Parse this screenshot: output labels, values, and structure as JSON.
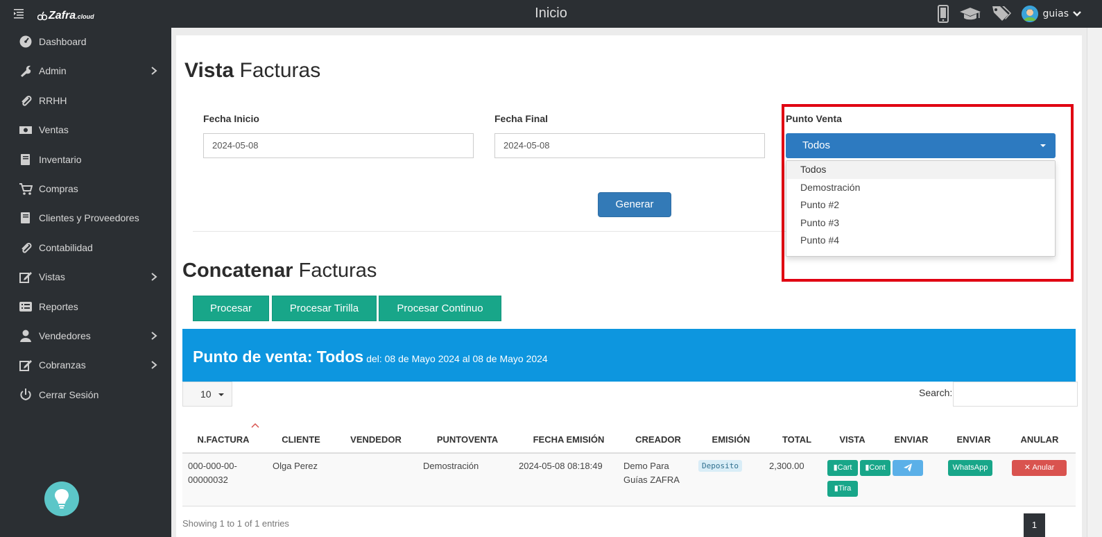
{
  "topbar": {
    "logo_text": "Zafra",
    "logo_suffix": ".cloud",
    "title": "Inicio",
    "username": "guias",
    "icons": [
      "mobile-icon",
      "graduation-cap-icon",
      "tags-icon",
      "user-avatar"
    ]
  },
  "sidebar": {
    "items": [
      {
        "label": "Dashboard",
        "icon": "dashboard-icon",
        "has_children": false
      },
      {
        "label": "Admin",
        "icon": "wrench-icon",
        "has_children": true
      },
      {
        "label": "RRHH",
        "icon": "paperclip-icon",
        "has_children": false
      },
      {
        "label": "Ventas",
        "icon": "money-icon",
        "has_children": false
      },
      {
        "label": "Inventario",
        "icon": "book-icon",
        "has_children": false
      },
      {
        "label": "Compras",
        "icon": "cart-icon",
        "has_children": false
      },
      {
        "label": "Clientes y Proveedores",
        "icon": "book-icon",
        "has_children": false
      },
      {
        "label": "Contabilidad",
        "icon": "paperclip-icon",
        "has_children": false
      },
      {
        "label": "Vistas",
        "icon": "edit-icon",
        "has_children": true
      },
      {
        "label": "Reportes",
        "icon": "list-icon",
        "has_children": false
      },
      {
        "label": "Vendedores",
        "icon": "user-icon",
        "has_children": true
      },
      {
        "label": "Cobranzas",
        "icon": "edit-icon",
        "has_children": true
      },
      {
        "label": "Cerrar Sesión",
        "icon": "power-icon",
        "has_children": false
      }
    ]
  },
  "vista": {
    "title_bold": "Vista",
    "title_rest": "Facturas",
    "fecha_inicio_label": "Fecha Inicio",
    "fecha_inicio_value": "2024-05-08",
    "fecha_final_label": "Fecha Final",
    "fecha_final_value": "2024-05-08",
    "punto_venta_label": "Punto Venta",
    "punto_venta_selected": "Todos",
    "punto_venta_options": [
      "Todos",
      "Demostración",
      "Punto #2",
      "Punto #3",
      "Punto #4"
    ],
    "generar_label": "Generar"
  },
  "concatenar": {
    "title_bold": "Concatenar",
    "title_rest": "Facturas",
    "buttons": [
      "Procesar",
      "Procesar Tirilla",
      "Procesar Continuo"
    ]
  },
  "banner": {
    "title": "Punto de venta: Todos",
    "date_range": "del: 08 de Mayo 2024 al 08 de Mayo 2024"
  },
  "table": {
    "page_length": "10",
    "search_label": "Search:",
    "columns": [
      "N.FACTURA",
      "CLIENTE",
      "VENDEDOR",
      "PUNTOVENTA",
      "FECHA EMISIÓN",
      "CREADOR",
      "EMISIÓN",
      "TOTAL",
      "VISTA",
      "ENVIAR",
      "ENVIAR",
      "ANULAR"
    ],
    "rows": [
      {
        "factura_line1": "000-000-00-",
        "factura_line2": "00000032",
        "cliente": "Olga Perez",
        "vendedor": "",
        "puntoventa": "Demostración",
        "fecha": "2024-05-08 08:18:49",
        "creador_line1": "Demo Para",
        "creador_line2": "Guías ZAFRA",
        "emision": "Deposito",
        "total": "2,300.00",
        "vista_buttons": [
          "Cart",
          "Cont",
          "Tira"
        ],
        "whatsapp_label": "WhatsApp",
        "anular_label": "Anular"
      }
    ],
    "info": "Showing 1 to 1 of 1 entries",
    "current_page": "1"
  },
  "colors": {
    "sidebar_bg": "#2b2f33",
    "primary_blue": "#337ab7",
    "select_blue": "#2d7ac0",
    "green": "#18a689",
    "banner_blue": "#0d96df",
    "highlight_red": "#e00012",
    "danger": "#d9534f"
  }
}
